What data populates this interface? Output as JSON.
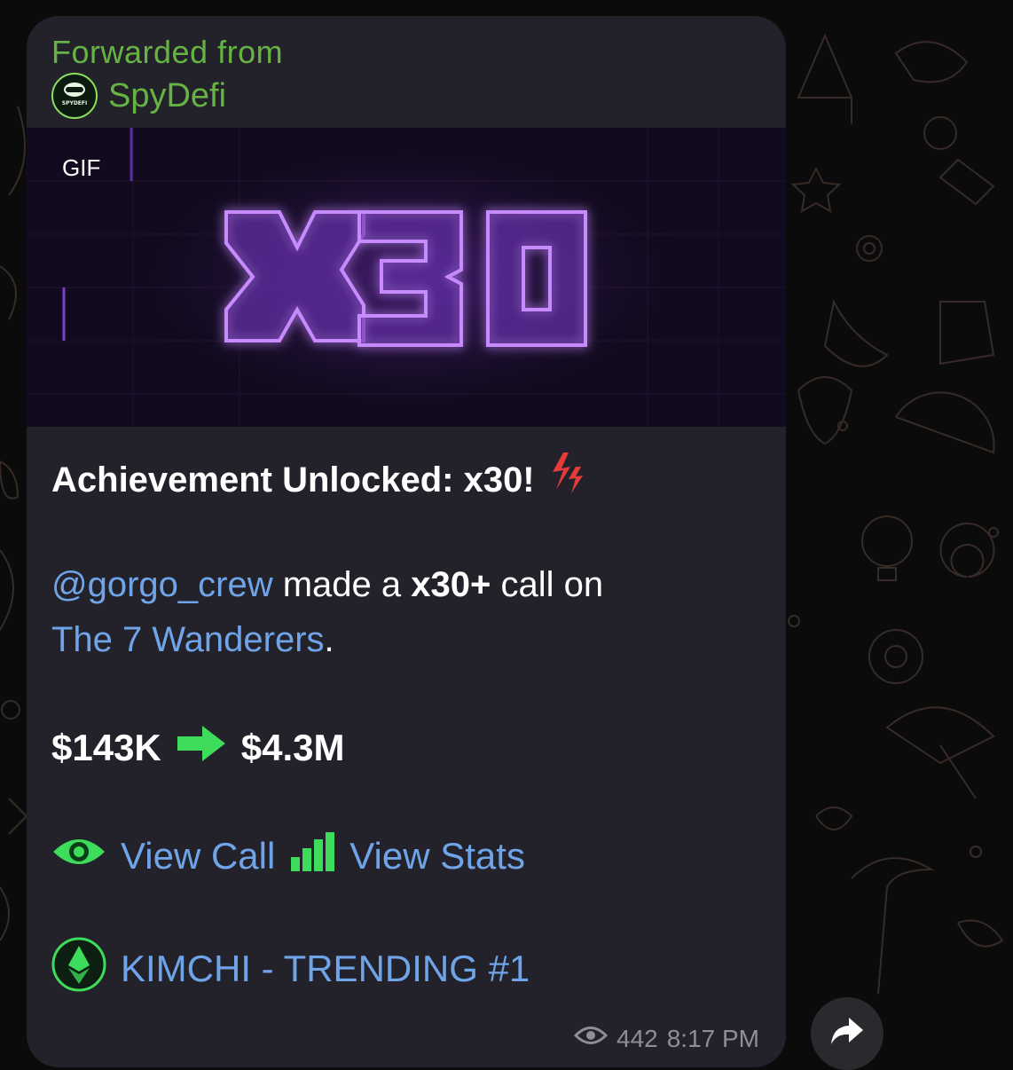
{
  "message": {
    "forwarded_label": "Forwarded from",
    "source_name": "SpyDefi",
    "source_avatar_text": "SPYDEFI",
    "media": {
      "badge": "GIF",
      "neon_text": "x30"
    },
    "headline": "Achievement Unlocked: x30!",
    "mention": "@gorgo_crew",
    "call_text_1": " made a ",
    "call_bold": "x30+",
    "call_text_2": " call on",
    "token_link": "The 7 Wanderers",
    "token_period": ".",
    "price_from": "$143K",
    "price_to": "$4.3M",
    "view_call_label": "View Call",
    "view_stats_label": "View Stats",
    "trending_label": "KIMCHI - TRENDING #1",
    "views": "442",
    "time": "8:17 PM"
  },
  "colors": {
    "bubble": "#23222b",
    "forward_green": "#66b344",
    "link_blue": "#6fa5e8",
    "arrow_green": "#3ddc5a",
    "neon_purple": "#b05cff"
  },
  "icons": {
    "headline": "lightning-icon",
    "price_arrow": "green-arrow-right-icon",
    "view_call": "eye-icon",
    "view_stats": "bar-chart-icon",
    "trending": "ethereum-icon",
    "views": "eye-outline-icon",
    "share": "share-arrow-icon"
  }
}
